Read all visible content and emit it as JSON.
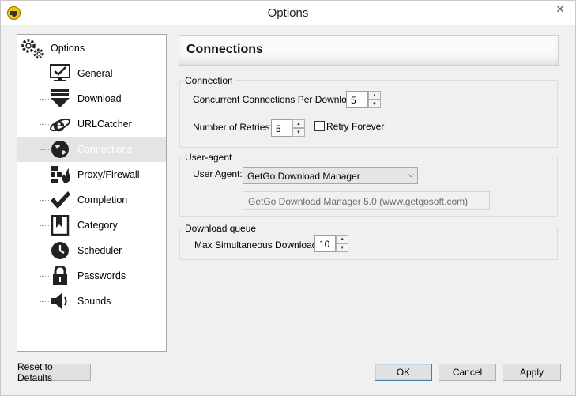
{
  "window": {
    "title": "Options"
  },
  "tree": {
    "root_label": "Options",
    "items": [
      {
        "label": "General",
        "icon": "monitor-check-icon"
      },
      {
        "label": "Download",
        "icon": "download-arrow-icon"
      },
      {
        "label": "URLCatcher",
        "icon": "ie-logo-icon"
      },
      {
        "label": "Connections",
        "icon": "globe-icon"
      },
      {
        "label": "Proxy/Firewall",
        "icon": "firewall-icon"
      },
      {
        "label": "Completion",
        "icon": "checkmark-icon"
      },
      {
        "label": "Category",
        "icon": "bookmark-icon"
      },
      {
        "label": "Scheduler",
        "icon": "clock-icon"
      },
      {
        "label": "Passwords",
        "icon": "padlock-icon"
      },
      {
        "label": "Sounds",
        "icon": "speaker-icon"
      }
    ],
    "selected_index": 3
  },
  "panel": {
    "header": "Connections",
    "connection": {
      "title": "Connection",
      "concurrent_label": "Concurrent Connections Per Download:",
      "concurrent_value": "5",
      "retries_label": "Number of Retries:",
      "retries_value": "5",
      "retry_forever_label": "Retry Forever",
      "retry_forever_checked": false
    },
    "user_agent": {
      "title": "User-agent",
      "label": "User Agent:",
      "selected": "GetGo Download Manager",
      "string": "GetGo Download Manager 5.0 (www.getgosoft.com)"
    },
    "queue": {
      "title": "Download queue",
      "max_label": "Max Simultaneous Downloads:",
      "max_value": "10"
    }
  },
  "buttons": {
    "reset": "Reset to Defaults",
    "ok": "OK",
    "cancel": "Cancel",
    "apply": "Apply"
  },
  "close_glyph": "✕"
}
